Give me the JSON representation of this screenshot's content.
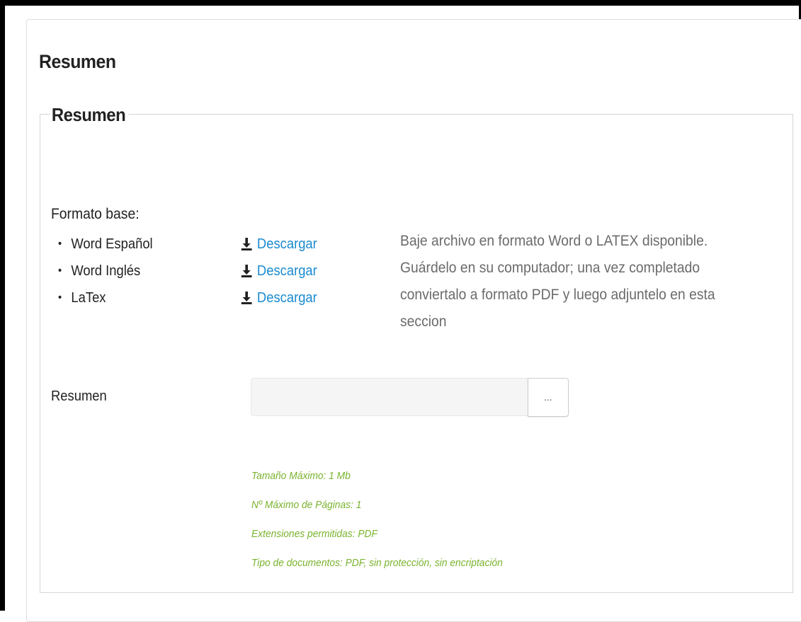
{
  "panel": {
    "title": "Resumen"
  },
  "section": {
    "legend": "Resumen",
    "base_format_label": "Formato base:",
    "formats": [
      {
        "name": "Word Español",
        "action": "Descargar",
        "icon": "download-icon"
      },
      {
        "name": "Word Inglés",
        "action": "Descargar",
        "icon": "download-icon"
      },
      {
        "name": "LaTex",
        "action": "Descargar",
        "icon": "download-icon"
      }
    ],
    "instructions": "Baje archivo en formato Word o LATEX disponible. Guárdelo en su computador; una vez completado conviertalo a formato PDF y luego adjuntelo en esta seccion"
  },
  "upload": {
    "label": "Resumen",
    "value": "",
    "button_label": "...",
    "rules": [
      "Tamaño Máximo: 1 Mb",
      "Nº Máximo de Páginas: 1",
      "Extensiones permitidas: PDF",
      "Tipo de documentos: PDF, sin protección, sin encriptación"
    ]
  },
  "colors": {
    "link": "#1a8bd0",
    "rules_text": "#7ab32e",
    "info_text": "#6b6b6b"
  }
}
